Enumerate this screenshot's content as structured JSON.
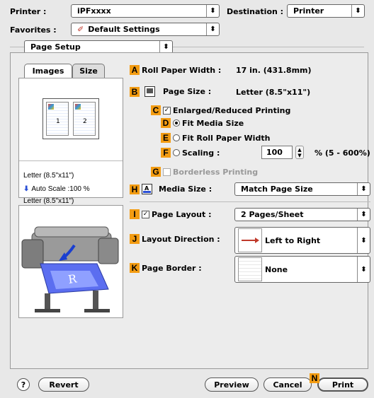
{
  "header": {
    "printer_label": "Printer :",
    "printer_value": "iPFxxxx",
    "destination_label": "Destination :",
    "destination_value": "Printer",
    "favorites_label": "Favorites :",
    "favorites_value": "Default Settings"
  },
  "panel_select": {
    "value": "Page Setup"
  },
  "tabs": {
    "images": "Images",
    "size": "Size"
  },
  "preview": {
    "page1": "1",
    "page2": "2",
    "info_top": "Letter (8.5\"x11\")",
    "auto_scale": "Auto Scale :100 %",
    "info_bottom": "Letter (8.5\"x11\")"
  },
  "markers": {
    "A": "A",
    "B": "B",
    "C": "C",
    "D": "D",
    "E": "E",
    "F": "F",
    "G": "G",
    "H": "H",
    "I": "I",
    "J": "J",
    "K": "K",
    "N": "N"
  },
  "settings": {
    "roll_paper_width_label": "Roll Paper Width :",
    "roll_paper_width_value": "17 in. (431.8mm)",
    "page_size_label": "Page Size :",
    "page_size_value": "Letter (8.5\"x11\")",
    "enlarged_reduced_label": "Enlarged/Reduced Printing",
    "fit_media_size_label": "Fit Media Size",
    "fit_roll_paper_width_label": "Fit Roll Paper Width",
    "scaling_label": "Scaling :",
    "scaling_value": "100",
    "scaling_range": "% (5 - 600%)",
    "borderless_label": "Borderless Printing",
    "media_size_label": "Media Size :",
    "media_size_value": "Match Page Size",
    "page_layout_label": "Page Layout :",
    "page_layout_value": "2 Pages/Sheet",
    "layout_direction_label": "Layout Direction :",
    "layout_direction_value": "Left to Right",
    "page_border_label": "Page Border :",
    "page_border_value": "None"
  },
  "footer": {
    "help_glyph": "?",
    "revert": "Revert",
    "preview": "Preview",
    "cancel": "Cancel",
    "print": "Print"
  },
  "colors": {
    "marker": "#f39c12",
    "highlight_blue": "#2a4fd6"
  },
  "icons": {
    "popup_arrows": "up-down-arrows-icon",
    "scale_arrow": "down-arrow-icon"
  }
}
